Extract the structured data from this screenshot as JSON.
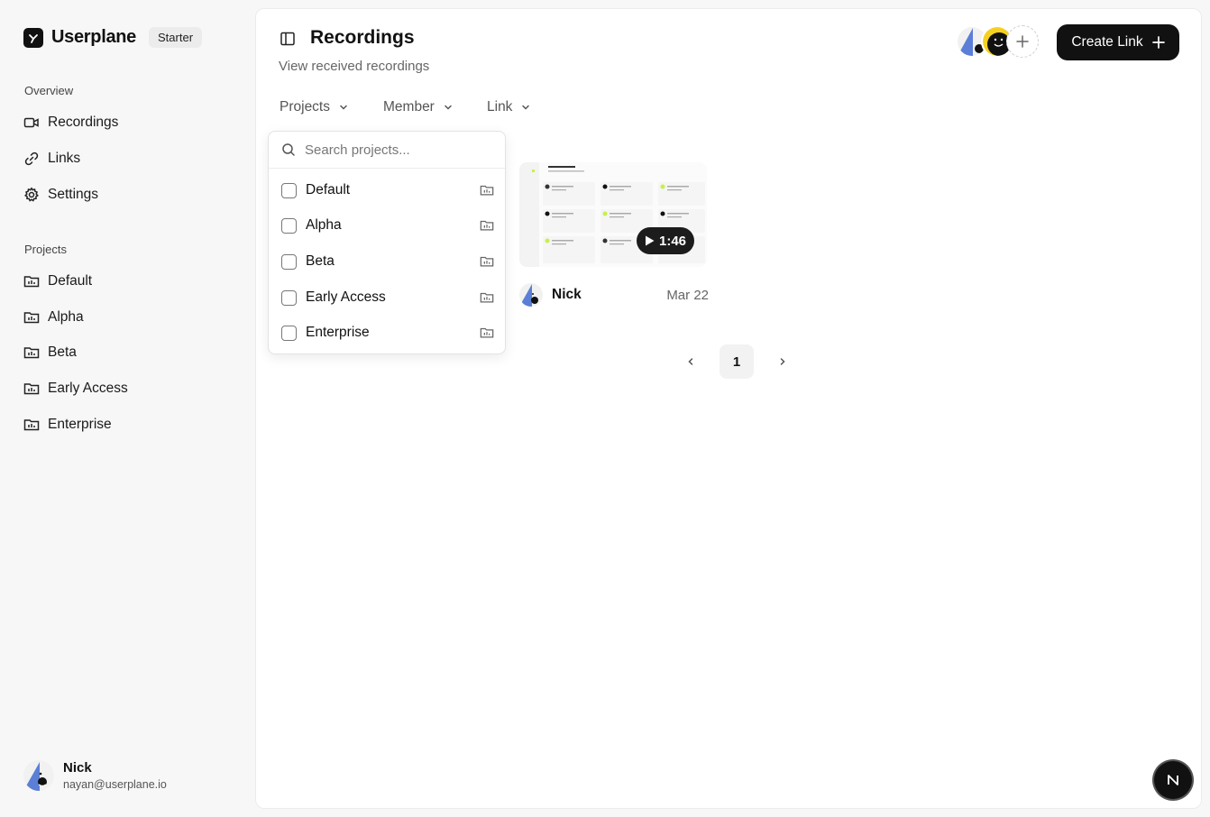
{
  "brand": {
    "name": "Userplane",
    "plan": "Starter"
  },
  "sidebar": {
    "overview_label": "Overview",
    "overview_items": [
      {
        "label": "Recordings",
        "icon": "video-icon"
      },
      {
        "label": "Links",
        "icon": "link-icon"
      },
      {
        "label": "Settings",
        "icon": "gear-icon"
      }
    ],
    "projects_label": "Projects",
    "project_items": [
      {
        "label": "Default",
        "icon": "folder-icon"
      },
      {
        "label": "Alpha",
        "icon": "folder-icon"
      },
      {
        "label": "Beta",
        "icon": "folder-icon"
      },
      {
        "label": "Early Access",
        "icon": "folder-icon"
      },
      {
        "label": "Enterprise",
        "icon": "folder-icon"
      }
    ]
  },
  "user": {
    "name": "Nick",
    "email": "nayan@userplane.io"
  },
  "header": {
    "title": "Recordings",
    "subtitle": "View received recordings",
    "create_link_label": "Create Link"
  },
  "filters": {
    "projects": "Projects",
    "member": "Member",
    "link": "Link"
  },
  "projects_dropdown": {
    "search_placeholder": "Search projects...",
    "options": [
      "Default",
      "Alpha",
      "Beta",
      "Early Access",
      "Enterprise"
    ]
  },
  "recordings": [
    {
      "author": "Nick",
      "date": "Mar 22",
      "duration": "1:46"
    }
  ],
  "pagination": {
    "current_page": "1"
  },
  "corner_badge": "N",
  "colors": {
    "primary": "#111111",
    "avatar_blue": "#5b7fd6",
    "avatar_yellow": "#f5d020",
    "accent_green": "#c8f04a"
  }
}
